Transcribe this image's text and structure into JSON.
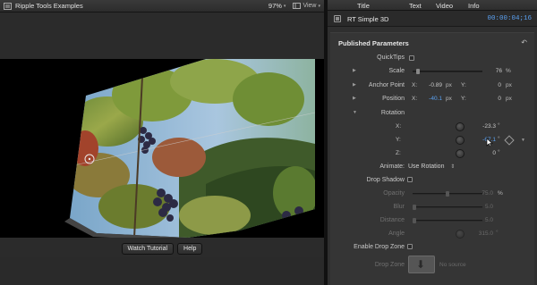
{
  "viewer": {
    "title": "Ripple Tools Examples",
    "zoom": "97%",
    "zoom_chevron": "▾",
    "view_button": "View",
    "view_chevron": "▾",
    "buttons": {
      "watch_tutorial": "Watch Tutorial",
      "help": "Help"
    }
  },
  "inspector": {
    "tabs": [
      "Title",
      "Text",
      "Video",
      "Info"
    ],
    "effect_name": "RT Simple 3D",
    "timecode": "00:00:04;16",
    "section_title": "Published Parameters",
    "reset_glyph": "↶",
    "params": {
      "quicktips": {
        "label": "QuickTips"
      },
      "scale": {
        "label": "Scale",
        "value": "76",
        "unit": "%",
        "level": 0.76
      },
      "anchor_point": {
        "label": "Anchor Point",
        "x_label": "X:",
        "x_value": "-0.89",
        "x_unit": "px",
        "y_label": "Y:",
        "y_value": "0",
        "y_unit": "px"
      },
      "position": {
        "label": "Position",
        "x_label": "X:",
        "x_value": "-40.1",
        "x_unit": "px",
        "y_label": "Y:",
        "y_value": "0",
        "y_unit": "px"
      },
      "rotation": {
        "label": "Rotation",
        "x_label": "X:",
        "x_value": "-23.3",
        "x_unit": "°",
        "y_label": "Y:",
        "y_value": "-67.1",
        "y_unit": "°",
        "z_label": "Z:",
        "z_value": "0",
        "z_unit": "°"
      },
      "animate": {
        "label": "Animate:",
        "value": "Use Rotation",
        "chevron": "⇕"
      },
      "drop_shadow": {
        "label": "Drop Shadow"
      },
      "opacity": {
        "label": "Opacity",
        "value": "75.0",
        "unit": "%",
        "level": 0.75
      },
      "blur": {
        "label": "Blur",
        "value": "5.0"
      },
      "distance": {
        "label": "Distance",
        "value": "5.0"
      },
      "angle": {
        "label": "Angle",
        "value": "315.0",
        "unit": "°"
      },
      "enable_drop_zone": {
        "label": "Enable Drop Zone"
      },
      "drop_zone": {
        "label": "Drop Zone",
        "status": "No source"
      }
    }
  },
  "colors": {
    "accent_blue": "#5aa0f0",
    "panel_bg": "#353535",
    "viewer_bg": "#2b2b2b"
  }
}
